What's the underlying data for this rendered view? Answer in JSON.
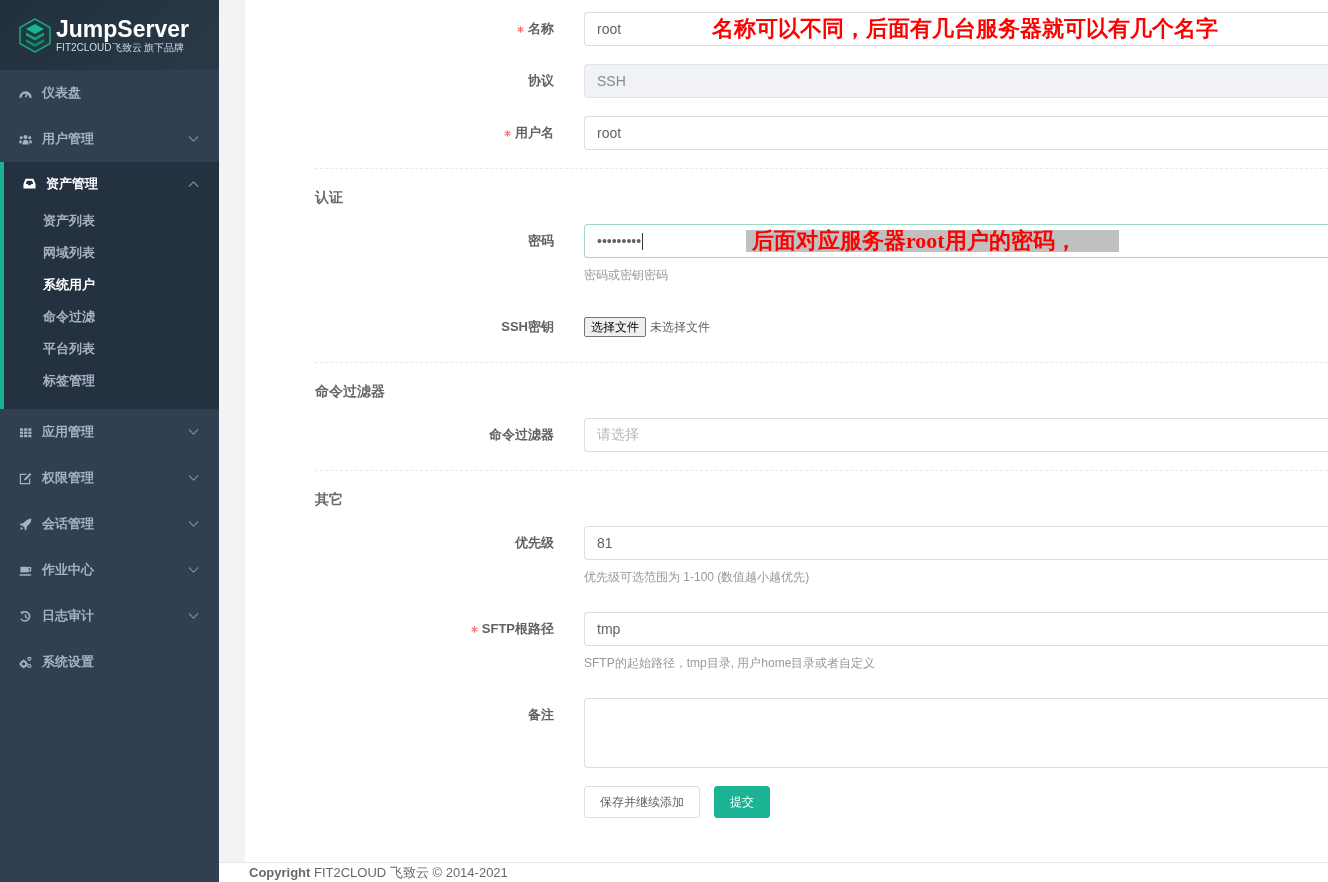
{
  "sidebar": {
    "logo": {
      "title": "JumpServer",
      "subtitle": "FIT2CLOUD飞致云 旗下品牌"
    },
    "items": [
      {
        "label": "仪表盘",
        "kind": "link"
      },
      {
        "label": "用户管理",
        "kind": "group",
        "expanded": false
      },
      {
        "label": "资产管理",
        "kind": "group",
        "expanded": true,
        "children": [
          {
            "label": "资产列表",
            "selected": false
          },
          {
            "label": "网域列表",
            "selected": false
          },
          {
            "label": "系统用户",
            "selected": true
          },
          {
            "label": "命令过滤",
            "selected": false
          },
          {
            "label": "平台列表",
            "selected": false
          },
          {
            "label": "标签管理",
            "selected": false
          }
        ]
      },
      {
        "label": "应用管理",
        "kind": "group",
        "expanded": false
      },
      {
        "label": "权限管理",
        "kind": "group",
        "expanded": false
      },
      {
        "label": "会话管理",
        "kind": "group",
        "expanded": false
      },
      {
        "label": "作业中心",
        "kind": "group",
        "expanded": false
      },
      {
        "label": "日志审计",
        "kind": "group",
        "expanded": false
      },
      {
        "label": "系统设置",
        "kind": "link"
      }
    ]
  },
  "form": {
    "sections": [
      {
        "rows": [
          {
            "label": "名称",
            "kind": "input",
            "required": true,
            "disabled": false,
            "focused": false,
            "value": "root",
            "annotation": {
              "text": "名称可以不同，后面有几台服务器就可以有几个名字",
              "highlighted": false
            }
          },
          {
            "label": "协议",
            "kind": "input",
            "required": false,
            "disabled": true,
            "focused": false,
            "value": "SSH"
          },
          {
            "label": "用户名",
            "kind": "input",
            "required": true,
            "disabled": false,
            "focused": false,
            "value": "root"
          }
        ]
      },
      {
        "title": "认证",
        "rows": [
          {
            "label": "密码",
            "kind": "password",
            "required": false,
            "disabled": false,
            "focused": true,
            "value": "•••••••••",
            "help": "密码或密钥密码",
            "annotation": {
              "text": "后面对应服务器root用户的密码，",
              "highlighted": true
            }
          },
          {
            "label": "SSH密钥",
            "kind": "file",
            "required": false,
            "disabled": false,
            "focused": false,
            "button": "选择文件",
            "status": "未选择文件"
          }
        ]
      },
      {
        "title": "命令过滤器",
        "rows": [
          {
            "label": "命令过滤器",
            "kind": "select",
            "required": false,
            "disabled": false,
            "focused": false,
            "placeholder": "请选择"
          }
        ]
      },
      {
        "title": "其它",
        "rows": [
          {
            "label": "优先级",
            "kind": "input",
            "required": false,
            "disabled": false,
            "focused": false,
            "value": "81",
            "help": "优先级可选范围为 1-100 (数值越小越优先)"
          },
          {
            "label": "SFTP根路径",
            "kind": "input",
            "required": true,
            "disabled": false,
            "focused": false,
            "value": "tmp",
            "help": "SFTP的起始路径，tmp目录, 用户home目录或者自定义"
          },
          {
            "label": "备注",
            "kind": "textarea",
            "required": false,
            "disabled": false,
            "focused": false
          }
        ]
      }
    ],
    "buttons": [
      {
        "label": "保存并继续添加",
        "kind": "default"
      },
      {
        "label": "提交",
        "kind": "primary"
      }
    ]
  },
  "footer": {
    "text": "**Copyright** FIT2CLOUD 飞致云 © 2014-2021"
  }
}
